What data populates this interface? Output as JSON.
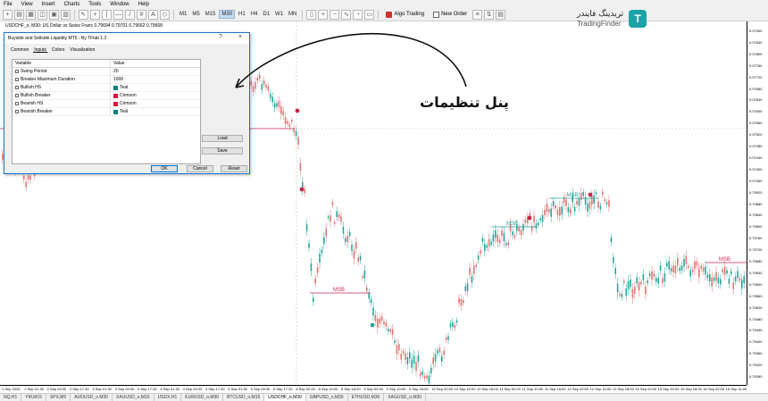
{
  "menu": [
    "File",
    "View",
    "Insert",
    "Charts",
    "Tools",
    "Window",
    "Help"
  ],
  "toolbar": {
    "timeframes": [
      "M1",
      "M5",
      "M15",
      "M30",
      "H1",
      "H4",
      "D1",
      "W1",
      "MN"
    ],
    "active_timeframe": "M30",
    "algo_trading": "Algo Trading",
    "new_order": "New Order"
  },
  "chart": {
    "title": "USDCHF_o, M30:  US Dollar vs Swiss Franc  0.79694 0.79701 0.79662 0.79668",
    "price_labels": [
      "0.07900",
      "0.07840",
      "0.07800",
      "0.07760",
      "0.07720",
      "0.07680",
      "0.07640",
      "0.07600",
      "0.07560",
      "0.07520",
      "0.07480",
      "0.07440",
      "0.07400",
      "0.07360",
      "0.79920",
      "0.79880",
      "0.79840",
      "0.79800",
      "0.79760",
      "0.79720",
      "0.79680",
      "0.79640",
      "0.79600",
      "0.79560",
      "0.79520",
      "0.79480",
      "0.79440",
      "0.79400",
      "0.79360",
      "0.79320",
      "0.79280"
    ],
    "time_labels": [
      "1 Sep 2025",
      "2 Sep 01:30",
      "2 Sep 09:30",
      "2 Sep 17:30",
      "3 Sep 01:30",
      "3 Sep 09:30",
      "3 Sep 17:30",
      "4 Sep 01:30",
      "4 Sep 09:30",
      "4 Sep 17:30",
      "5 Sep 01:30",
      "5 Sep 09:30",
      "5 Sep 17:30",
      "8 Sep 02:00",
      "8 Sep 10:00",
      "8 Sep 18:00",
      "9 Sep 02:00",
      "9 Sep 10:00",
      "9 Sep 18:00",
      "10 Sep 02:00",
      "10 Sep 10:00",
      "10 Sep 18:00",
      "11 Sep 02:00",
      "11 Sep 10:00",
      "11 Sep 18:00",
      "12 Sep 02:00",
      "12 Sep 10:00",
      "12 Sep 18:00",
      "15 Sep 02:00",
      "15 Sep 10:00",
      "15 Sep 18:00",
      "16 Sep 02:00",
      "16 Sep 11:00"
    ],
    "msb_labels": [
      "MSB",
      "MSB",
      "MSB",
      "MSB"
    ],
    "colors": {
      "bull": "#26a69a",
      "bear": "#c62850",
      "grid": "#b4d2b4",
      "up_candle": "#26a69a",
      "down_candle": "#e57373"
    }
  },
  "dialog": {
    "title": "Buyside and Sellside Liquidity MT5 - By TFlab 1.2",
    "tabs": [
      "Common",
      "Inputs",
      "Colors",
      "Visualization"
    ],
    "active_tab": "Inputs",
    "columns": [
      "Variable",
      "Value"
    ],
    "params": [
      {
        "name": "Swing Period",
        "value": "20",
        "icon": "int-icon",
        "color": ""
      },
      {
        "name": "Breaker Maximum Duration",
        "value": "1000",
        "icon": "int-icon",
        "color": ""
      },
      {
        "name": "Bullish HS",
        "value": "Teal",
        "icon": "color-param-icon",
        "color": "#008080"
      },
      {
        "name": "Bullish Breaker",
        "value": "Crimson",
        "icon": "color-param-icon",
        "color": "#dc143c"
      },
      {
        "name": "Bearish HS",
        "value": "Crimson",
        "icon": "color-param-icon",
        "color": "#dc143c"
      },
      {
        "name": "Bearish Breaker",
        "value": "Teal",
        "icon": "color-param-icon",
        "color": "#008080"
      }
    ],
    "buttons": {
      "load": "Load",
      "save": "Save",
      "ok": "OK",
      "cancel": "Cancel",
      "reset": "Reset"
    }
  },
  "annotation": {
    "text": "پنل تنظیمات"
  },
  "logo": {
    "fa": "تریدینگ فایندر",
    "en": "TradingFinder"
  },
  "tabs": [
    "NQ,H1",
    "YM,M15",
    "SPX,M5",
    "AUDUSD_o,M30",
    "XAUUSD_o,M15",
    "USDX,H1",
    "EURUSD_o,M30",
    "BTCUSD_o,M15",
    "USDCHF_o,M30",
    "GBPUSD_o,M30",
    "ETHUSD,M30",
    "XAGUSD_o,M30"
  ],
  "active_tab": "USDCHF_o,M30"
}
